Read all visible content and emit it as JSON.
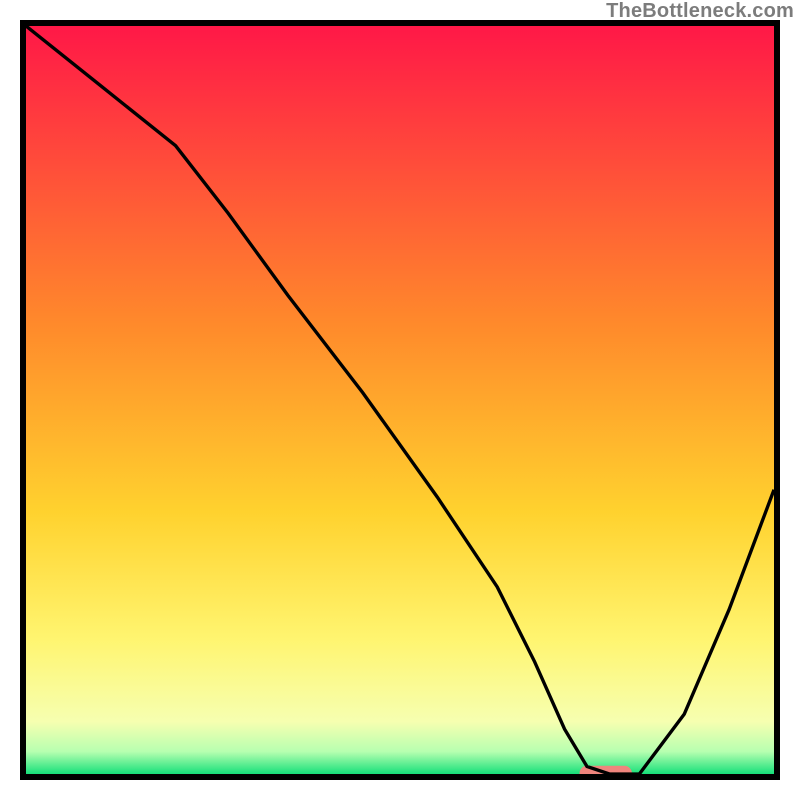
{
  "watermark": "TheBottleneck.com",
  "chart_data": {
    "type": "line",
    "title": "",
    "xlabel": "",
    "ylabel": "",
    "xlim": [
      0,
      100
    ],
    "ylim": [
      0,
      100
    ],
    "grid": false,
    "background_gradient": {
      "stops": [
        {
          "offset": 0,
          "color": "#ff1847"
        },
        {
          "offset": 40,
          "color": "#ff8a2b"
        },
        {
          "offset": 65,
          "color": "#ffd22e"
        },
        {
          "offset": 82,
          "color": "#fff570"
        },
        {
          "offset": 93,
          "color": "#f6ffb0"
        },
        {
          "offset": 97,
          "color": "#b7ffb0"
        },
        {
          "offset": 100,
          "color": "#16e07a"
        }
      ]
    },
    "series": [
      {
        "name": "bottleneck-curve",
        "color": "#000000",
        "x": [
          0,
          10,
          20,
          27,
          35,
          45,
          55,
          63,
          68,
          72,
          75,
          78,
          82,
          88,
          94,
          100
        ],
        "y": [
          100,
          92,
          84,
          75,
          64,
          51,
          37,
          25,
          15,
          6,
          1,
          0,
          0,
          8,
          22,
          38
        ]
      }
    ],
    "marker": {
      "name": "optimal-range",
      "color": "#ef857d",
      "x_start": 74,
      "x_end": 81,
      "y": 0,
      "thickness_pct": 2.2
    }
  }
}
